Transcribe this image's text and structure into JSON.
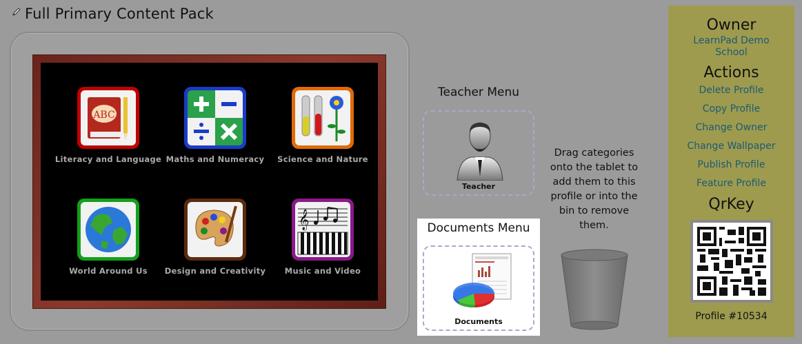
{
  "page": {
    "title": "Full Primary Content Pack"
  },
  "categories": [
    {
      "label": "Literacy and Language",
      "icon": "book-abc-icon",
      "border": "#c00000"
    },
    {
      "label": "Maths and Numeracy",
      "icon": "math-symbols-icon",
      "border": "#1a3cc8"
    },
    {
      "label": "Science and Nature",
      "icon": "test-tubes-flower-icon",
      "border": "#e06a0a"
    },
    {
      "label": "World Around Us",
      "icon": "globe-icon",
      "border": "#13a01c"
    },
    {
      "label": "Design and Creativity",
      "icon": "paint-palette-icon",
      "border": "#5a2b0e"
    },
    {
      "label": "Music and Video",
      "icon": "music-keyboard-icon",
      "border": "#8a1a8a"
    }
  ],
  "teacher_menu": {
    "title": "Teacher Menu",
    "item": "Teacher"
  },
  "documents_menu": {
    "title": "Documents Menu",
    "item": "Documents"
  },
  "drag_help": "Drag categories onto the tablet to add them to this profile or into the bin to remove them.",
  "sidebar": {
    "owner_heading": "Owner",
    "owner_name": "LearnPad Demo School",
    "actions_heading": "Actions",
    "actions": [
      "Delete Profile",
      "Copy Profile",
      "Change Owner",
      "Change Wallpaper",
      "Publish Profile",
      "Feature Profile"
    ],
    "qr_heading": "QrKey",
    "profile_label": "Profile #10534"
  }
}
